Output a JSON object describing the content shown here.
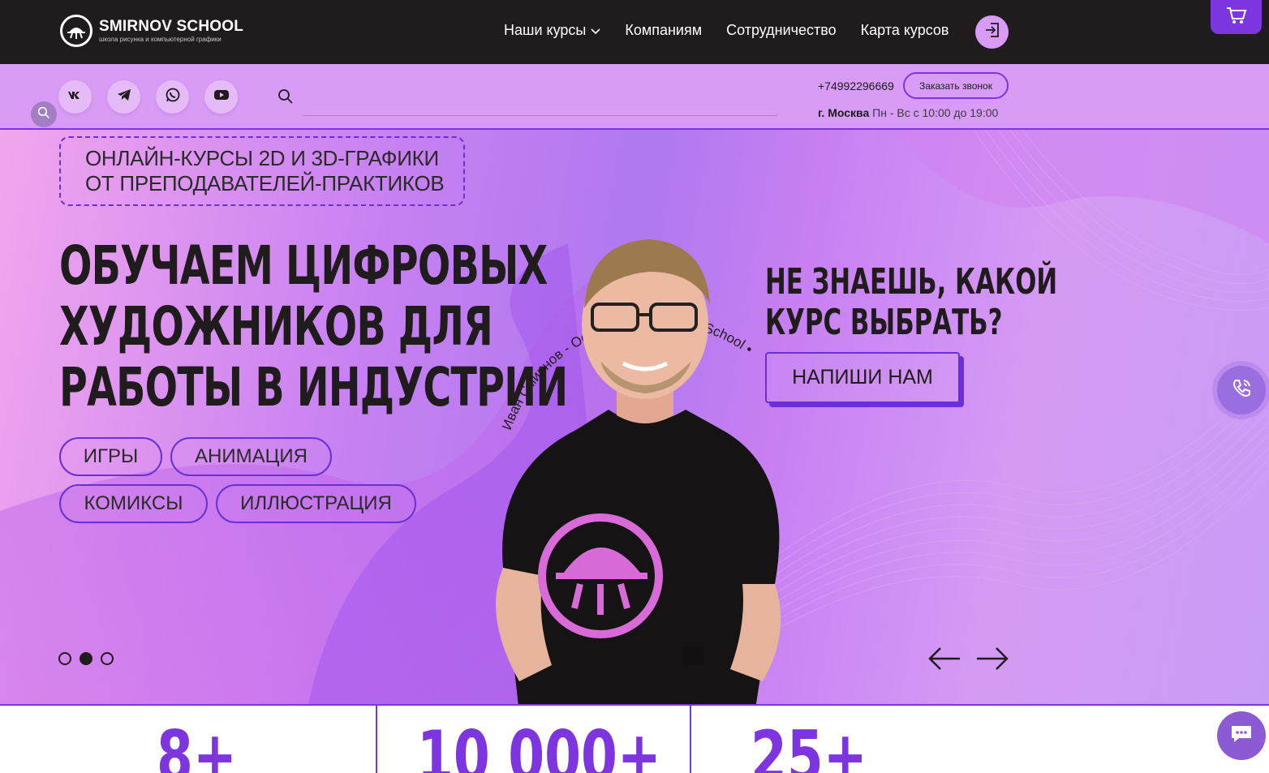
{
  "brand": {
    "name": "SMIRNOV SCHOOL",
    "tagline": "школа рисунка и компьютерной графики"
  },
  "nav": {
    "items": [
      {
        "label": "Наши курсы",
        "icon": "chevron-down-icon"
      },
      {
        "label": "Компаниям"
      },
      {
        "label": "Сотрудничество"
      },
      {
        "label": "Карта курсов"
      }
    ],
    "login_icon": "login-icon",
    "cart_icon": "cart-icon"
  },
  "subbar": {
    "social": [
      "vk-icon",
      "telegram-icon",
      "whatsapp-icon",
      "youtube-icon"
    ],
    "search": {
      "placeholder": "",
      "value": ""
    },
    "phone": "+74992296669",
    "callback_label": "Заказать звонок",
    "city": "г. Москва",
    "hours": "Пн - Вс с 10:00 до 19:00"
  },
  "hero": {
    "badge_line1": "ОНЛАЙН-КУРСЫ 2D И 3D-ГРАФИКИ",
    "badge_line2": "ОТ ПРЕПОДАВАТЕЛЕЙ-ПРАКТИКОВ",
    "headline": [
      "ОБУЧАЕМ ЦИФРОВЫХ",
      "ХУДОЖНИКОВ ДЛЯ",
      "РАБОТЫ В ИНДУСТРИИ"
    ],
    "tags": [
      "ИГРЫ",
      "АНИМАЦИЯ",
      "КОМИКСЫ",
      "ИЛЛЮСТРАЦИЯ"
    ],
    "question": [
      "НЕ ЗНАЕШЬ, КАКОЙ",
      "КУРС ВЫБРАТЬ?"
    ],
    "cta_label": "НАПИШИ НАМ",
    "circle_text": "Иван Смирнов - Основатель Smirnov School •",
    "slides_total": 3,
    "active_slide": 2
  },
  "stats": [
    "8+",
    "10 000+",
    "25+"
  ],
  "colors": {
    "accent": "#7d35e0",
    "topbar": "#201c1d",
    "subbar": "#d89cf6",
    "text_dark": "#201c1d"
  }
}
